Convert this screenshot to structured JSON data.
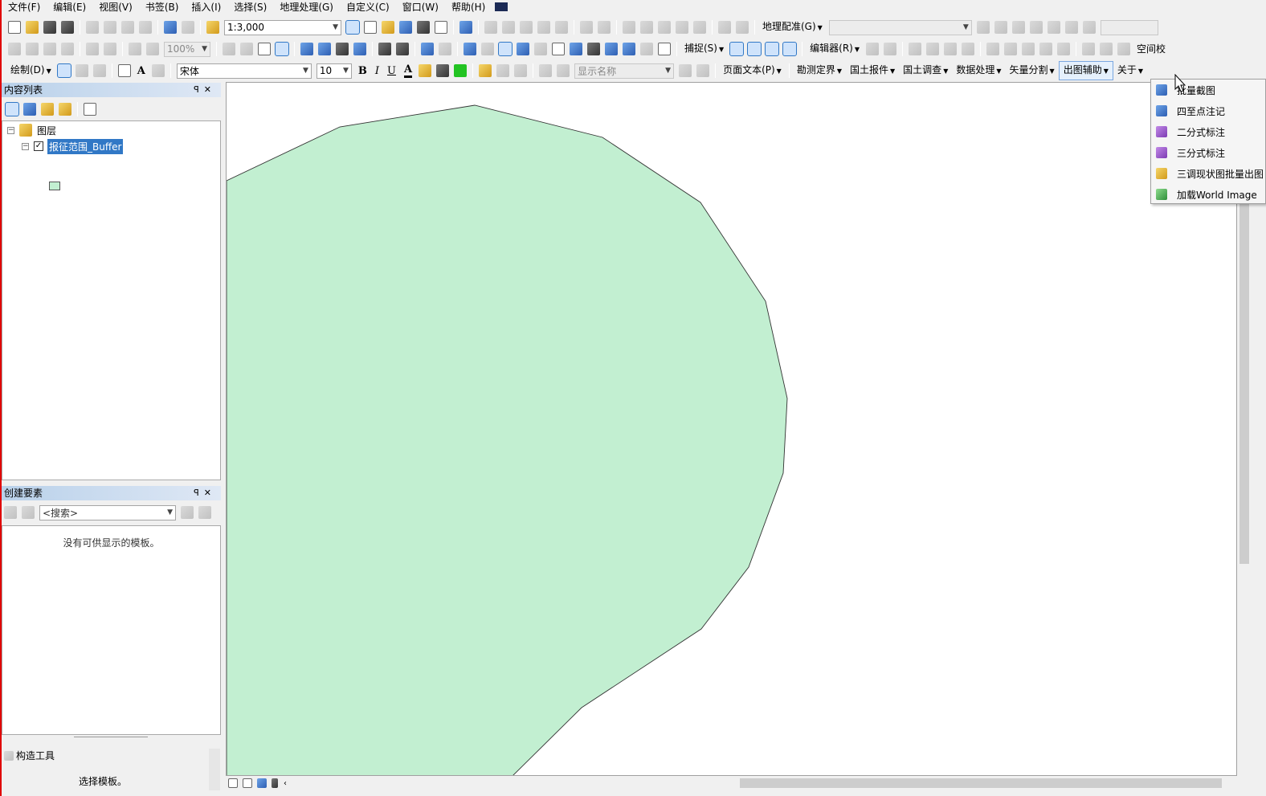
{
  "menubar": {
    "items": [
      "文件(F)",
      "编辑(E)",
      "视图(V)",
      "书签(B)",
      "插入(I)",
      "选择(S)",
      "地理处理(G)",
      "自定义(C)",
      "窗口(W)",
      "帮助(H)"
    ]
  },
  "toolbar1": {
    "scale": "1:3,000",
    "georef_label": "地理配准(G)"
  },
  "toolbar2": {
    "zoom": "100%",
    "snap_label": "捕捉(S)",
    "editor_label": "编辑器(R)",
    "spatial_label": "空间校"
  },
  "toolbar3": {
    "draw_label": "绘制(D)",
    "font": "宋体",
    "font_size": "10",
    "bold": "B",
    "italic": "I",
    "underline": "U",
    "font_color_glyph": "A",
    "display_name": "显示名称",
    "page_text": "页面文本(P)",
    "menus": [
      "勘测定界",
      "国土报件",
      "国土调查",
      "数据处理",
      "矢量分割",
      "出图辅助",
      "关于"
    ]
  },
  "toc": {
    "title": "内容列表",
    "root_label": "图层",
    "layer_name": "报征范围_Buffer"
  },
  "create_features": {
    "title": "创建要素",
    "search_placeholder": "<搜索>",
    "empty_message": "没有可供显示的模板。"
  },
  "construct_tools": {
    "title": "构造工具",
    "hint": "选择模板。"
  },
  "dropdown": {
    "items": [
      "批量截图",
      "四至点注记",
      "二分式标注",
      "三分式标注",
      "三调现状图批量出图",
      "加载World Image"
    ]
  },
  "colors": {
    "polygon_fill": "#c2efd1",
    "selection": "#3178c6",
    "window_border": "#e00000"
  }
}
